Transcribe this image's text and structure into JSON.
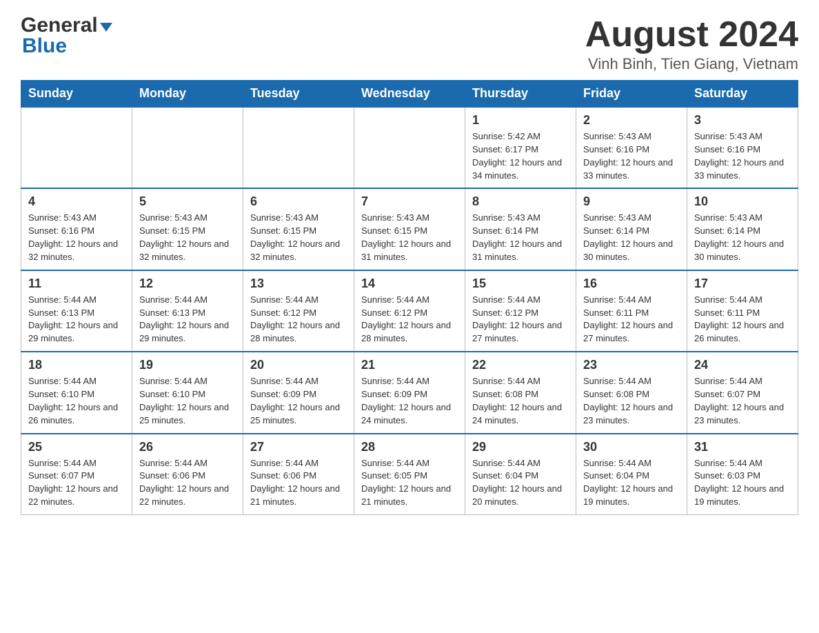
{
  "header": {
    "logo_general": "General",
    "logo_blue": "Blue",
    "main_title": "August 2024",
    "subtitle": "Vinh Binh, Tien Giang, Vietnam"
  },
  "days_of_week": [
    "Sunday",
    "Monday",
    "Tuesday",
    "Wednesday",
    "Thursday",
    "Friday",
    "Saturday"
  ],
  "weeks": [
    [
      {
        "day": "",
        "detail": ""
      },
      {
        "day": "",
        "detail": ""
      },
      {
        "day": "",
        "detail": ""
      },
      {
        "day": "",
        "detail": ""
      },
      {
        "day": "1",
        "detail": "Sunrise: 5:42 AM\nSunset: 6:17 PM\nDaylight: 12 hours and 34 minutes."
      },
      {
        "day": "2",
        "detail": "Sunrise: 5:43 AM\nSunset: 6:16 PM\nDaylight: 12 hours and 33 minutes."
      },
      {
        "day": "3",
        "detail": "Sunrise: 5:43 AM\nSunset: 6:16 PM\nDaylight: 12 hours and 33 minutes."
      }
    ],
    [
      {
        "day": "4",
        "detail": "Sunrise: 5:43 AM\nSunset: 6:16 PM\nDaylight: 12 hours and 32 minutes."
      },
      {
        "day": "5",
        "detail": "Sunrise: 5:43 AM\nSunset: 6:15 PM\nDaylight: 12 hours and 32 minutes."
      },
      {
        "day": "6",
        "detail": "Sunrise: 5:43 AM\nSunset: 6:15 PM\nDaylight: 12 hours and 32 minutes."
      },
      {
        "day": "7",
        "detail": "Sunrise: 5:43 AM\nSunset: 6:15 PM\nDaylight: 12 hours and 31 minutes."
      },
      {
        "day": "8",
        "detail": "Sunrise: 5:43 AM\nSunset: 6:14 PM\nDaylight: 12 hours and 31 minutes."
      },
      {
        "day": "9",
        "detail": "Sunrise: 5:43 AM\nSunset: 6:14 PM\nDaylight: 12 hours and 30 minutes."
      },
      {
        "day": "10",
        "detail": "Sunrise: 5:43 AM\nSunset: 6:14 PM\nDaylight: 12 hours and 30 minutes."
      }
    ],
    [
      {
        "day": "11",
        "detail": "Sunrise: 5:44 AM\nSunset: 6:13 PM\nDaylight: 12 hours and 29 minutes."
      },
      {
        "day": "12",
        "detail": "Sunrise: 5:44 AM\nSunset: 6:13 PM\nDaylight: 12 hours and 29 minutes."
      },
      {
        "day": "13",
        "detail": "Sunrise: 5:44 AM\nSunset: 6:12 PM\nDaylight: 12 hours and 28 minutes."
      },
      {
        "day": "14",
        "detail": "Sunrise: 5:44 AM\nSunset: 6:12 PM\nDaylight: 12 hours and 28 minutes."
      },
      {
        "day": "15",
        "detail": "Sunrise: 5:44 AM\nSunset: 6:12 PM\nDaylight: 12 hours and 27 minutes."
      },
      {
        "day": "16",
        "detail": "Sunrise: 5:44 AM\nSunset: 6:11 PM\nDaylight: 12 hours and 27 minutes."
      },
      {
        "day": "17",
        "detail": "Sunrise: 5:44 AM\nSunset: 6:11 PM\nDaylight: 12 hours and 26 minutes."
      }
    ],
    [
      {
        "day": "18",
        "detail": "Sunrise: 5:44 AM\nSunset: 6:10 PM\nDaylight: 12 hours and 26 minutes."
      },
      {
        "day": "19",
        "detail": "Sunrise: 5:44 AM\nSunset: 6:10 PM\nDaylight: 12 hours and 25 minutes."
      },
      {
        "day": "20",
        "detail": "Sunrise: 5:44 AM\nSunset: 6:09 PM\nDaylight: 12 hours and 25 minutes."
      },
      {
        "day": "21",
        "detail": "Sunrise: 5:44 AM\nSunset: 6:09 PM\nDaylight: 12 hours and 24 minutes."
      },
      {
        "day": "22",
        "detail": "Sunrise: 5:44 AM\nSunset: 6:08 PM\nDaylight: 12 hours and 24 minutes."
      },
      {
        "day": "23",
        "detail": "Sunrise: 5:44 AM\nSunset: 6:08 PM\nDaylight: 12 hours and 23 minutes."
      },
      {
        "day": "24",
        "detail": "Sunrise: 5:44 AM\nSunset: 6:07 PM\nDaylight: 12 hours and 23 minutes."
      }
    ],
    [
      {
        "day": "25",
        "detail": "Sunrise: 5:44 AM\nSunset: 6:07 PM\nDaylight: 12 hours and 22 minutes."
      },
      {
        "day": "26",
        "detail": "Sunrise: 5:44 AM\nSunset: 6:06 PM\nDaylight: 12 hours and 22 minutes."
      },
      {
        "day": "27",
        "detail": "Sunrise: 5:44 AM\nSunset: 6:06 PM\nDaylight: 12 hours and 21 minutes."
      },
      {
        "day": "28",
        "detail": "Sunrise: 5:44 AM\nSunset: 6:05 PM\nDaylight: 12 hours and 21 minutes."
      },
      {
        "day": "29",
        "detail": "Sunrise: 5:44 AM\nSunset: 6:04 PM\nDaylight: 12 hours and 20 minutes."
      },
      {
        "day": "30",
        "detail": "Sunrise: 5:44 AM\nSunset: 6:04 PM\nDaylight: 12 hours and 19 minutes."
      },
      {
        "day": "31",
        "detail": "Sunrise: 5:44 AM\nSunset: 6:03 PM\nDaylight: 12 hours and 19 minutes."
      }
    ]
  ]
}
